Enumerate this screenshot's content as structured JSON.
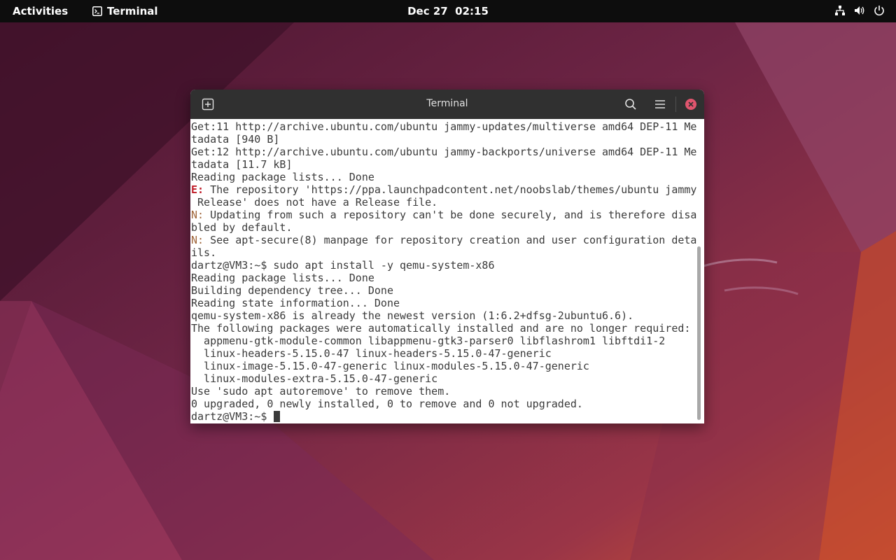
{
  "topbar": {
    "activities_label": "Activities",
    "app_name": "Terminal",
    "clock": "Dec 27  02:15",
    "tray_icons": [
      "network-icon",
      "volume-icon",
      "power-icon"
    ]
  },
  "window": {
    "title": "Terminal"
  },
  "terminal": {
    "lines": [
      {
        "text": "Get:11 http://archive.ubuntu.com/ubuntu jammy-updates/multiverse amd64 DEP-11 Me"
      },
      {
        "text": "tadata [940 B]"
      },
      {
        "text": "Get:12 http://archive.ubuntu.com/ubuntu jammy-backports/universe amd64 DEP-11 Me"
      },
      {
        "text": "tadata [11.7 kB]"
      },
      {
        "text": "Reading package lists... Done"
      },
      {
        "prefix": "E:",
        "prefix_type": "err",
        "text": " The repository 'https://ppa.launchpadcontent.net/noobslab/themes/ubuntu jammy"
      },
      {
        "text": " Release' does not have a Release file."
      },
      {
        "prefix": "N:",
        "prefix_type": "note",
        "text": " Updating from such a repository can't be done securely, and is therefore disa"
      },
      {
        "text": "bled by default."
      },
      {
        "prefix": "N:",
        "prefix_type": "note",
        "text": " See apt-secure(8) manpage for repository creation and user configuration deta"
      },
      {
        "text": "ils."
      },
      {
        "text": "dartz@VM3:~$ sudo apt install -y qemu-system-x86"
      },
      {
        "text": "Reading package lists... Done"
      },
      {
        "text": "Building dependency tree... Done"
      },
      {
        "text": "Reading state information... Done"
      },
      {
        "text": "qemu-system-x86 is already the newest version (1:6.2+dfsg-2ubuntu6.6)."
      },
      {
        "text": "The following packages were automatically installed and are no longer required:"
      },
      {
        "text": "  appmenu-gtk-module-common libappmenu-gtk3-parser0 libflashrom1 libftdi1-2"
      },
      {
        "text": "  linux-headers-5.15.0-47 linux-headers-5.15.0-47-generic"
      },
      {
        "text": "  linux-image-5.15.0-47-generic linux-modules-5.15.0-47-generic"
      },
      {
        "text": "  linux-modules-extra-5.15.0-47-generic"
      },
      {
        "text": "Use 'sudo apt autoremove' to remove them."
      },
      {
        "text": "0 upgraded, 0 newly installed, 0 to remove and 0 not upgraded."
      }
    ],
    "prompt": "dartz@VM3:~$ "
  },
  "colors": {
    "error_prefix": "#c01c28",
    "note_prefix": "#a0673c",
    "close_button": "#e0556e",
    "topbar": "#0d0d0d",
    "headerbar": "#303030"
  }
}
